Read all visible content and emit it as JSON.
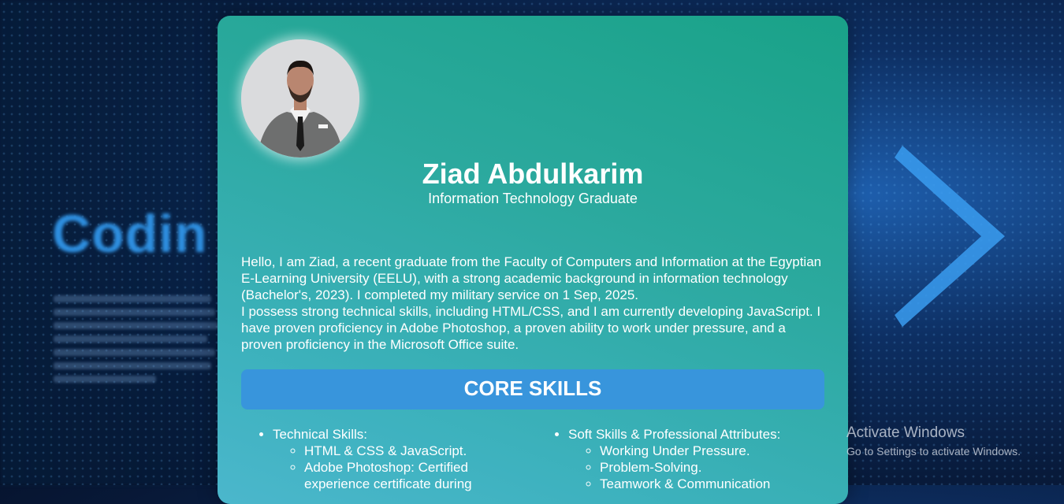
{
  "background": {
    "word": "Codin"
  },
  "profile": {
    "name": "Ziad Abdulkarim",
    "title": "Information Technology Graduate"
  },
  "bio": {
    "paragraph1": "Hello, I am Ziad, a recent graduate from the Faculty of Computers and Information at the Egyptian E-Learning University (EELU), with a strong academic background in information technology (Bachelor's, 2023). I completed my military service on 1 Sep, 2025.",
    "paragraph2": "I possess strong technical skills, including HTML/CSS, and I am currently developing JavaScript. I have proven proficiency in Adobe Photoshop, a proven ability to work under pressure, and a proven proficiency in the Microsoft Office suite."
  },
  "skills": {
    "header": "CORE SKILLS",
    "technical": {
      "label": "Technical Skills:",
      "items": [
        "HTML & CSS & JavaScript.",
        "Adobe Photoshop: Certified experience certificate during"
      ]
    },
    "soft": {
      "label": "Soft Skills & Professional Attributes:",
      "items": [
        "Working Under Pressure.",
        "Problem-Solving.",
        "Teamwork & Communication"
      ]
    }
  },
  "watermark": {
    "line1": "Activate Windows",
    "line2": "Go to Settings to activate Windows."
  },
  "colors": {
    "card_top": "#19a288",
    "card_bottom": "#4bb7cc",
    "skills_header_bg": "#3895dc",
    "text": "#ffffff"
  }
}
